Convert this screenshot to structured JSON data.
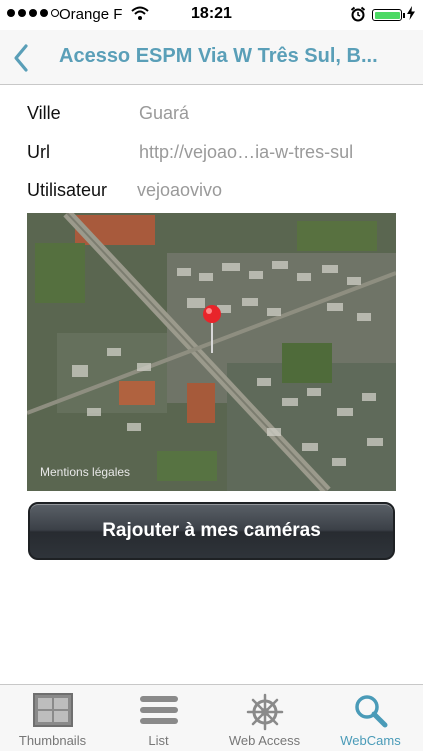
{
  "status_bar": {
    "carrier": "Orange F",
    "time": "18:21",
    "signal_bars_filled": 4,
    "signal_bars_total": 5,
    "battery_level": 1.0,
    "charging": true,
    "alarm": true
  },
  "nav": {
    "back_icon": "chevron-left-icon",
    "title": "Acesso ESPM Via W Três Sul, B..."
  },
  "info": [
    {
      "label": "Ville",
      "value": "Guará"
    },
    {
      "label": "Url",
      "value": "http://vejoao…ia-w-tres-sul"
    },
    {
      "label": "Utilisateur",
      "value": "vejoaovivo"
    }
  ],
  "map": {
    "legal_label": "Mentions légales",
    "pin_color": "#e8242a"
  },
  "action_button": {
    "label": "Rajouter à mes caméras"
  },
  "tabbar": {
    "accent_color": "#4a9bb8",
    "active_tab": "WebCams",
    "tabs": [
      {
        "label": "Thumbnails",
        "icon": "grid-icon"
      },
      {
        "label": "List",
        "icon": "list-icon"
      },
      {
        "label": "Web Access",
        "icon": "ship-wheel-icon"
      },
      {
        "label": "WebCams",
        "icon": "magnifier-icon"
      }
    ]
  }
}
